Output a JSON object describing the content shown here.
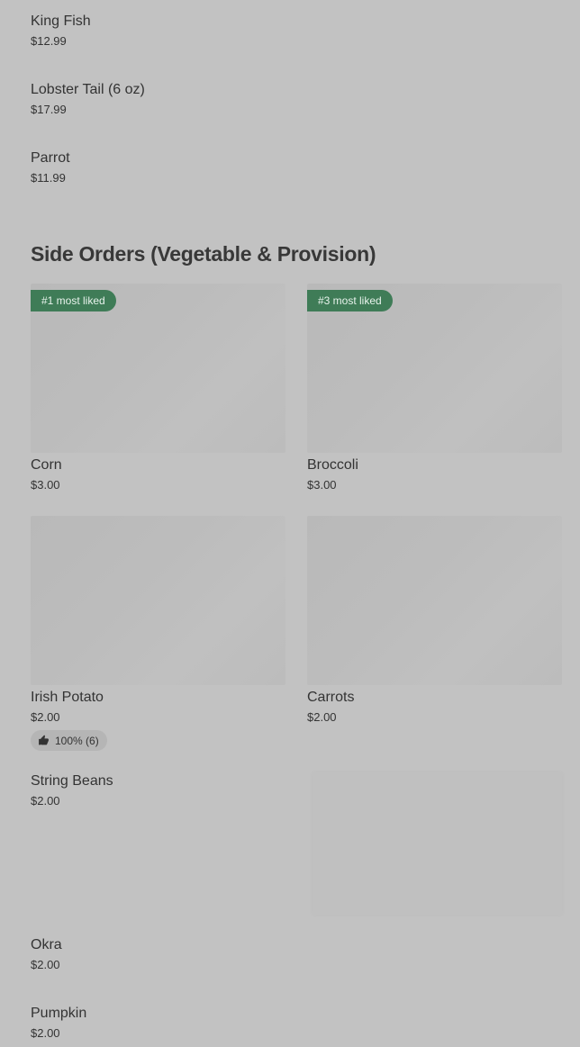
{
  "top_items": [
    {
      "name": "King Fish",
      "price": "$12.99"
    },
    {
      "name": "Lobster Tail (6 oz)",
      "price": "$17.99"
    },
    {
      "name": "Parrot",
      "price": "$11.99"
    }
  ],
  "section": {
    "title": "Side Orders (Vegetable & Provision)"
  },
  "cards": [
    {
      "name": "Corn",
      "price": "$3.00",
      "badge": "#1 most liked"
    },
    {
      "name": "Broccoli",
      "price": "$3.00",
      "badge": "#3 most liked"
    },
    {
      "name": "Irish Potato",
      "price": "$2.00",
      "rating": "100% (6)"
    },
    {
      "name": "Carrots",
      "price": "$2.00"
    }
  ],
  "bottom_items": [
    {
      "name": "String Beans",
      "price": "$2.00"
    },
    {
      "name": "Okra",
      "price": "$2.00"
    },
    {
      "name": "Pumpkin",
      "price": "$2.00"
    }
  ],
  "icons": {
    "rating": "thumbs-up-icon"
  },
  "colors": {
    "background": "#c2c2c2",
    "badge": "#3f7c57",
    "text": "#333333"
  }
}
